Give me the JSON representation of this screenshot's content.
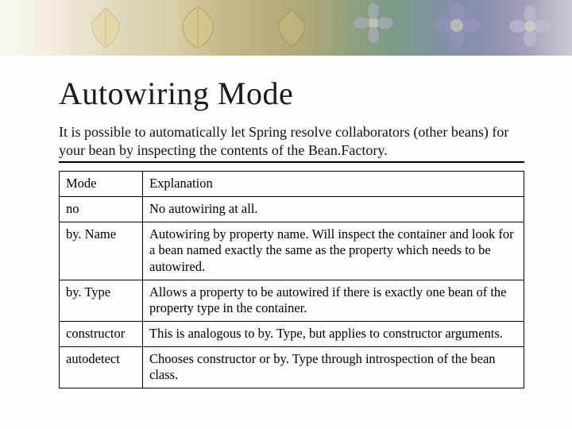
{
  "title": "Autowiring Mode",
  "intro": "It is possible to automatically let Spring resolve collaborators (other beans) for your bean by inspecting the contents of the Bean.Factory.",
  "table": {
    "headers": {
      "mode": "Mode",
      "explanation": "Explanation"
    },
    "rows": [
      {
        "mode": "no",
        "explanation": "No autowiring at all."
      },
      {
        "mode": "by. Name",
        "explanation": "Autowiring by property name. Will inspect the container and look for a bean named exactly the same as the property which needs to be autowired."
      },
      {
        "mode": "by. Type",
        "explanation": "Allows a property to be autowired if there is exactly one bean of the property type in the container."
      },
      {
        "mode": "constructor",
        "explanation": "This is analogous to by. Type, but applies to constructor arguments."
      },
      {
        "mode": "autodetect",
        "explanation": "Chooses constructor or by. Type through introspection of the bean class."
      }
    ]
  }
}
